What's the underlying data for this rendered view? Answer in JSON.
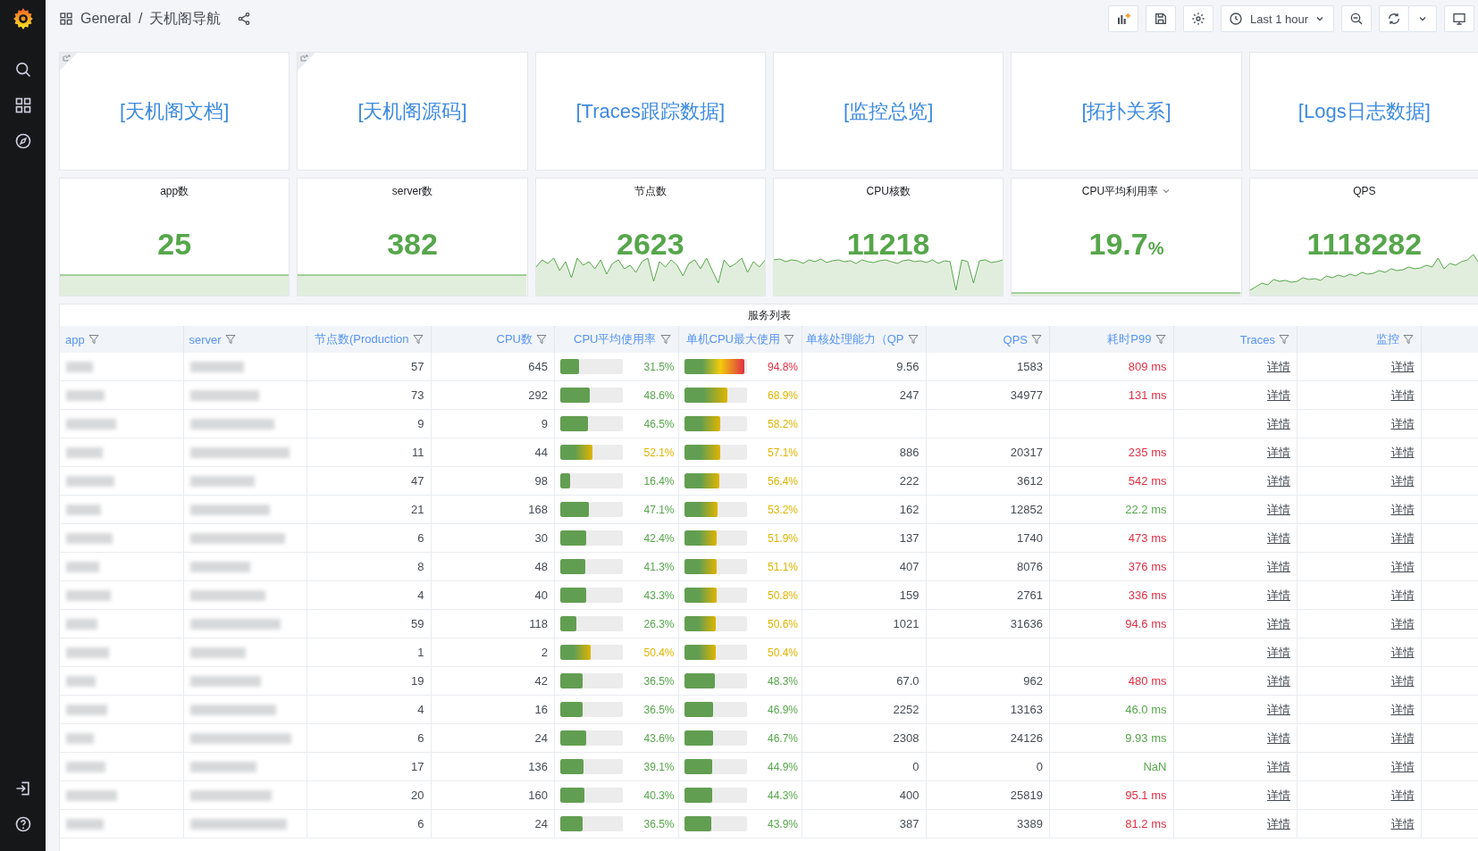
{
  "breadcrumb": {
    "folder": "General",
    "separator": "/",
    "title": "天机阁导航"
  },
  "time_picker": {
    "label": "Last 1 hour"
  },
  "link_panels": [
    {
      "label": "[天机阁文档]",
      "link_icon": true
    },
    {
      "label": "[天机阁源码]",
      "link_icon": true
    },
    {
      "label": "[Traces跟踪数据]",
      "link_icon": false
    },
    {
      "label": "[监控总览]",
      "link_icon": false
    },
    {
      "label": "[拓扑关系]",
      "link_icon": false
    },
    {
      "label": "[Logs日志数据]",
      "link_icon": false
    }
  ],
  "stats": [
    {
      "title": "app数",
      "value": "25",
      "kind": "flat",
      "has_menu": false
    },
    {
      "title": "server数",
      "value": "382",
      "kind": "flat",
      "has_menu": false
    },
    {
      "title": "节点数",
      "value": "2623",
      "kind": "noisy",
      "has_menu": false
    },
    {
      "title": "CPU核数",
      "value": "11218",
      "kind": "dips",
      "has_menu": false
    },
    {
      "title": "CPU平均利用率",
      "value": "19.7",
      "unit": "%",
      "kind": "baseline",
      "has_menu": true
    },
    {
      "title": "QPS",
      "value": "1118282",
      "kind": "rising",
      "has_menu": false
    }
  ],
  "table": {
    "title": "服务列表",
    "columns": [
      {
        "label": "app"
      },
      {
        "label": "server"
      },
      {
        "label": "节点数(Production"
      },
      {
        "label": "CPU数"
      },
      {
        "label": "CPU平均使用率"
      },
      {
        "label": "单机CPU最大使用"
      },
      {
        "label": "单核处理能力（QP"
      },
      {
        "label": "QPS"
      },
      {
        "label": "耗时P99"
      },
      {
        "label": "Traces"
      },
      {
        "label": "监控"
      }
    ],
    "rows": [
      {
        "nodes": "57",
        "cpus": "645",
        "cpu_avg": {
          "text": "31.5%",
          "level": 0.32,
          "color": "#56a64b"
        },
        "cpu_max": {
          "text": "94.8%",
          "level": 1.0,
          "color": "#e02f44"
        },
        "per_core": "9.56",
        "qps": "1583",
        "p99": {
          "text": "809 ms",
          "color": "#e02f44"
        },
        "traces": "详情",
        "monitor": "详情"
      },
      {
        "nodes": "73",
        "cpus": "292",
        "cpu_avg": {
          "text": "48.6%",
          "level": 0.49,
          "color": "#56a64b"
        },
        "cpu_max": {
          "text": "68.9%",
          "level": 0.73,
          "color": "#e0b400"
        },
        "per_core": "247",
        "qps": "34977",
        "p99": {
          "text": "131 ms",
          "color": "#e02f44"
        },
        "traces": "详情",
        "monitor": "详情"
      },
      {
        "nodes": "9",
        "cpus": "9",
        "cpu_avg": {
          "text": "46.5%",
          "level": 0.47,
          "color": "#56a64b"
        },
        "cpu_max": {
          "text": "58.2%",
          "level": 0.61,
          "color": "#e0b400"
        },
        "traces": "详情",
        "monitor": "详情"
      },
      {
        "nodes": "11",
        "cpus": "44",
        "cpu_avg": {
          "text": "52.1%",
          "level": 0.53,
          "color": "#e0b400"
        },
        "cpu_max": {
          "text": "57.1%",
          "level": 0.6,
          "color": "#e0b400"
        },
        "per_core": "886",
        "qps": "20317",
        "p99": {
          "text": "235 ms",
          "color": "#e02f44"
        },
        "traces": "详情",
        "monitor": "详情"
      },
      {
        "nodes": "47",
        "cpus": "98",
        "cpu_avg": {
          "text": "16.4%",
          "level": 0.17,
          "color": "#56a64b"
        },
        "cpu_max": {
          "text": "56.4%",
          "level": 0.59,
          "color": "#e0b400"
        },
        "per_core": "222",
        "qps": "3612",
        "p99": {
          "text": "542 ms",
          "color": "#e02f44"
        },
        "traces": "详情",
        "monitor": "详情"
      },
      {
        "nodes": "21",
        "cpus": "168",
        "cpu_avg": {
          "text": "47.1%",
          "level": 0.48,
          "color": "#56a64b"
        },
        "cpu_max": {
          "text": "53.2%",
          "level": 0.56,
          "color": "#e0b400"
        },
        "per_core": "162",
        "qps": "12852",
        "p99": {
          "text": "22.2 ms",
          "color": "#56a64b"
        },
        "traces": "详情",
        "monitor": "详情"
      },
      {
        "nodes": "6",
        "cpus": "30",
        "cpu_avg": {
          "text": "42.4%",
          "level": 0.43,
          "color": "#56a64b"
        },
        "cpu_max": {
          "text": "51.9%",
          "level": 0.55,
          "color": "#e0b400"
        },
        "per_core": "137",
        "qps": "1740",
        "p99": {
          "text": "473 ms",
          "color": "#e02f44"
        },
        "traces": "详情",
        "monitor": "详情"
      },
      {
        "nodes": "8",
        "cpus": "48",
        "cpu_avg": {
          "text": "41.3%",
          "level": 0.42,
          "color": "#56a64b"
        },
        "cpu_max": {
          "text": "51.1%",
          "level": 0.54,
          "color": "#e0b400"
        },
        "per_core": "407",
        "qps": "8076",
        "p99": {
          "text": "376 ms",
          "color": "#e02f44"
        },
        "traces": "详情",
        "monitor": "详情"
      },
      {
        "nodes": "4",
        "cpus": "40",
        "cpu_avg": {
          "text": "43.3%",
          "level": 0.44,
          "color": "#56a64b"
        },
        "cpu_max": {
          "text": "50.8%",
          "level": 0.54,
          "color": "#e0b400"
        },
        "per_core": "159",
        "qps": "2761",
        "p99": {
          "text": "336 ms",
          "color": "#e02f44"
        },
        "traces": "详情",
        "monitor": "详情"
      },
      {
        "nodes": "59",
        "cpus": "118",
        "cpu_avg": {
          "text": "26.3%",
          "level": 0.27,
          "color": "#56a64b"
        },
        "cpu_max": {
          "text": "50.6%",
          "level": 0.53,
          "color": "#e0b400"
        },
        "per_core": "1021",
        "qps": "31636",
        "p99": {
          "text": "94.6 ms",
          "color": "#e02f44"
        },
        "traces": "详情",
        "monitor": "详情"
      },
      {
        "nodes": "1",
        "cpus": "2",
        "cpu_avg": {
          "text": "50.4%",
          "level": 0.51,
          "color": "#e0b400"
        },
        "cpu_max": {
          "text": "50.4%",
          "level": 0.53,
          "color": "#e0b400"
        },
        "traces": "详情",
        "monitor": "详情"
      },
      {
        "nodes": "19",
        "cpus": "42",
        "cpu_avg": {
          "text": "36.5%",
          "level": 0.37,
          "color": "#56a64b"
        },
        "cpu_max": {
          "text": "48.3%",
          "level": 0.51,
          "color": "#56a64b"
        },
        "per_core": "67.0",
        "qps": "962",
        "p99": {
          "text": "480 ms",
          "color": "#e02f44"
        },
        "traces": "详情",
        "monitor": "详情"
      },
      {
        "nodes": "4",
        "cpus": "16",
        "cpu_avg": {
          "text": "36.5%",
          "level": 0.37,
          "color": "#56a64b"
        },
        "cpu_max": {
          "text": "46.9%",
          "level": 0.49,
          "color": "#56a64b"
        },
        "per_core": "2252",
        "qps": "13163",
        "p99": {
          "text": "46.0 ms",
          "color": "#56a64b"
        },
        "traces": "详情",
        "monitor": "详情"
      },
      {
        "nodes": "6",
        "cpus": "24",
        "cpu_avg": {
          "text": "43.6%",
          "level": 0.44,
          "color": "#56a64b"
        },
        "cpu_max": {
          "text": "46.7%",
          "level": 0.49,
          "color": "#56a64b"
        },
        "per_core": "2308",
        "qps": "24126",
        "p99": {
          "text": "9.93 ms",
          "color": "#56a64b"
        },
        "traces": "详情",
        "monitor": "详情"
      },
      {
        "nodes": "17",
        "cpus": "136",
        "cpu_avg": {
          "text": "39.1%",
          "level": 0.39,
          "color": "#56a64b"
        },
        "cpu_max": {
          "text": "44.9%",
          "level": 0.47,
          "color": "#56a64b"
        },
        "per_core": "0",
        "qps": "0",
        "p99": {
          "text": "NaN",
          "color": "#56a64b"
        },
        "traces": "详情",
        "monitor": "详情"
      },
      {
        "nodes": "20",
        "cpus": "160",
        "cpu_avg": {
          "text": "40.3%",
          "level": 0.41,
          "color": "#56a64b"
        },
        "cpu_max": {
          "text": "44.3%",
          "level": 0.47,
          "color": "#56a64b"
        },
        "per_core": "400",
        "qps": "25819",
        "p99": {
          "text": "95.1 ms",
          "color": "#e02f44"
        },
        "traces": "详情",
        "monitor": "详情"
      },
      {
        "nodes": "6",
        "cpus": "24",
        "cpu_avg": {
          "text": "36.5%",
          "level": 0.37,
          "color": "#56a64b"
        },
        "cpu_max": {
          "text": "43.9%",
          "level": 0.46,
          "color": "#56a64b"
        },
        "per_core": "387",
        "qps": "3389",
        "p99": {
          "text": "81.2 ms",
          "color": "#e02f44"
        },
        "traces": "详情",
        "monitor": "详情"
      }
    ]
  }
}
